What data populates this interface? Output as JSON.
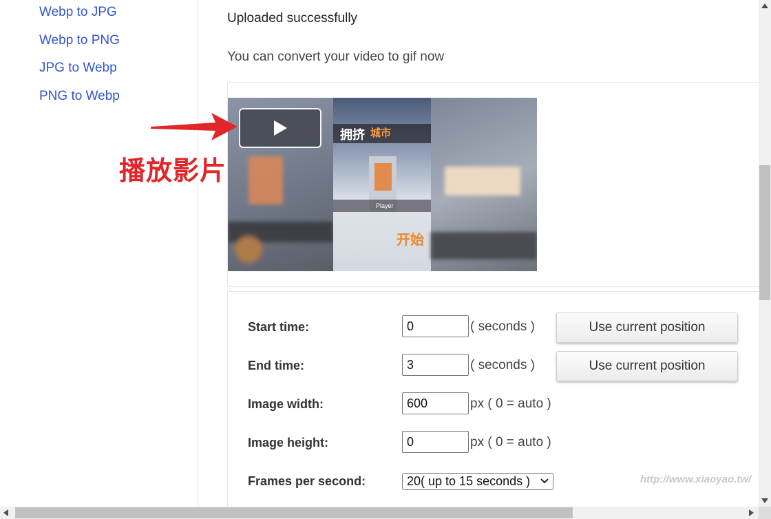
{
  "sidebar": {
    "links": [
      "Webp to JPG",
      "Webp to PNG",
      "JPG to Webp",
      "PNG to Webp"
    ]
  },
  "main": {
    "status": "Uploaded successfully",
    "hint": "You can convert your video to gif now"
  },
  "video": {
    "play_icon": "play-icon",
    "frame_text": {
      "title1": "拥挤",
      "title2": "城市",
      "start": "开始",
      "player": "Player"
    }
  },
  "annotation": {
    "text": "播放影片",
    "color": "#e0262a"
  },
  "form": {
    "start_time": {
      "label": "Start time:",
      "value": "0",
      "unit": "( seconds )",
      "button": "Use current position"
    },
    "end_time": {
      "label": "End time:",
      "value": "3",
      "unit": "( seconds )",
      "button": "Use current position"
    },
    "image_width": {
      "label": "Image width:",
      "value": "600",
      "unit": "px ( 0 = auto )"
    },
    "image_height": {
      "label": "Image height:",
      "value": "0",
      "unit": "px ( 0 = auto )"
    },
    "fps": {
      "label": "Frames per second:",
      "selected": "20( up to 15 seconds )"
    }
  },
  "watermark": "http://www.xiaoyao.tw/",
  "colors": {
    "link": "#3355cc",
    "accent_red": "#e0262a"
  }
}
